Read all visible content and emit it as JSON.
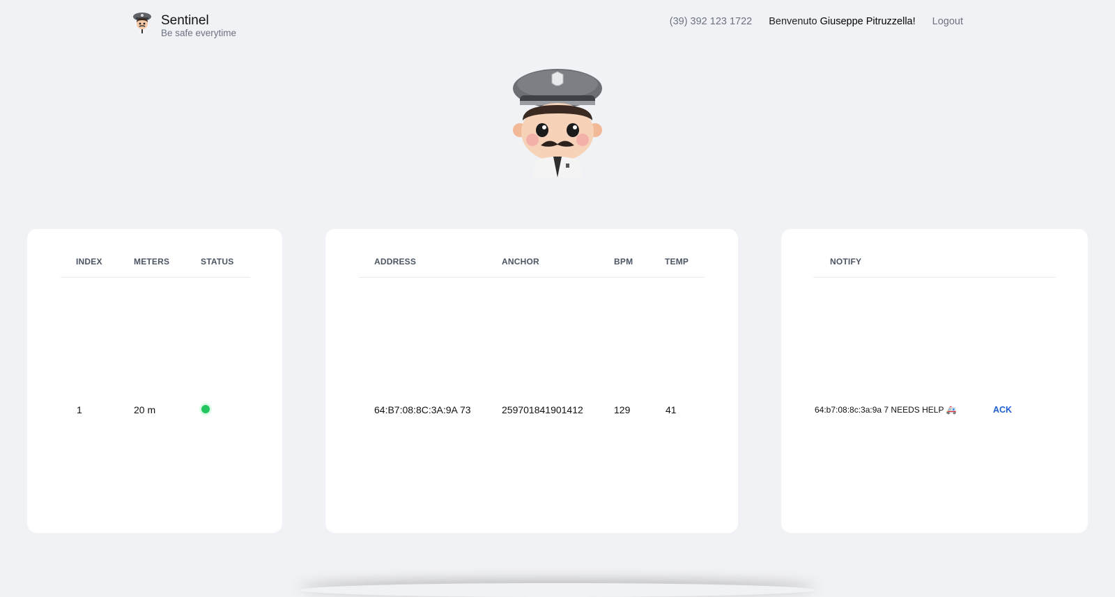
{
  "brand": {
    "name": "Sentinel",
    "tagline": "Be safe everytime"
  },
  "nav": {
    "phone": "(39) 392 123 1722",
    "welcome_prefix": "Benvenuto",
    "user_name": "Giuseppe Pitruzzella!",
    "logout_label": "Logout"
  },
  "devices_table": {
    "headers": [
      "INDEX",
      "METERS",
      "STATUS"
    ],
    "rows": [
      {
        "index": "1",
        "meters": "20 m",
        "status": "online",
        "status_color": "#22c55e"
      }
    ]
  },
  "readings_table": {
    "headers": [
      "ADDRESS",
      "ANCHOR",
      "BPM",
      "TEMP"
    ],
    "rows": [
      {
        "address": "64:B7:08:8C:3A:9A 73",
        "anchor": "259701841901412",
        "bpm": "129",
        "temp": "41"
      }
    ]
  },
  "notify_table": {
    "headers": [
      "NOTIFY"
    ],
    "rows": [
      {
        "message": "64:b7:08:8c:3a:9a 7 NEEDS HELP 🚑",
        "action_label": "ACK"
      }
    ]
  },
  "colors": {
    "background": "#f1f2f5",
    "accent": "#1d5fd1",
    "status_ok": "#22c55e"
  },
  "icons": {
    "brand_logo": "policeman-mascot-icon",
    "hero": "policeman-mascot-illustration"
  }
}
